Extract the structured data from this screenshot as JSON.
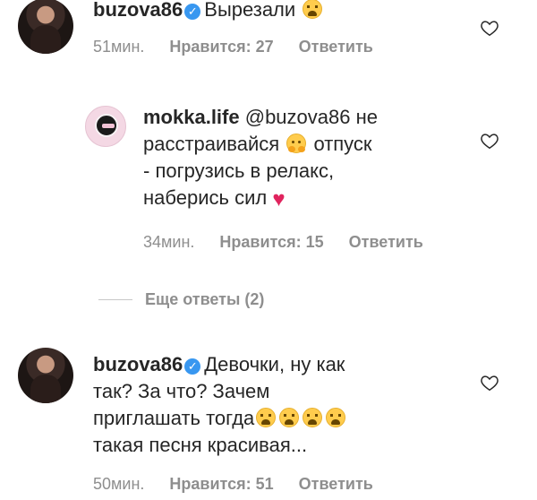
{
  "comments": [
    {
      "username": "buzova86",
      "text": "Вырезали",
      "time": "51мин.",
      "likes": "Нравится: 27",
      "reply": "Ответить",
      "verified": true
    },
    {
      "username": "mokka.life",
      "mention": "@buzova86",
      "line1_after_mention": "не",
      "line2_a": "расстраивайся",
      "line2_b": "отпуск",
      "line3": "- погрузись в релакс,",
      "line4": "наберись сил",
      "time": "34мин.",
      "likes": "Нравится: 15",
      "reply": "Ответить"
    },
    {
      "username": "buzova86",
      "line1": "Девочки, ну как",
      "line2": "так? За что? Зачем",
      "line3": "приглашать тогда",
      "line4": "такая песня красивая...",
      "time": "50мин.",
      "likes": "Нравится: 51",
      "reply": "Ответить",
      "verified": true
    }
  ],
  "more_replies": "Еще ответы (2)",
  "icons": {
    "verified": "verified-badge-icon",
    "like": "heart-outline-icon",
    "crying": "loudly-crying-face-emoji",
    "hugging": "hugging-face-emoji",
    "heart": "red-heart-emoji"
  },
  "colors": {
    "text": "#262626",
    "meta": "#8e8e8e",
    "verified": "#3897f0",
    "heart": "#e0245e"
  }
}
